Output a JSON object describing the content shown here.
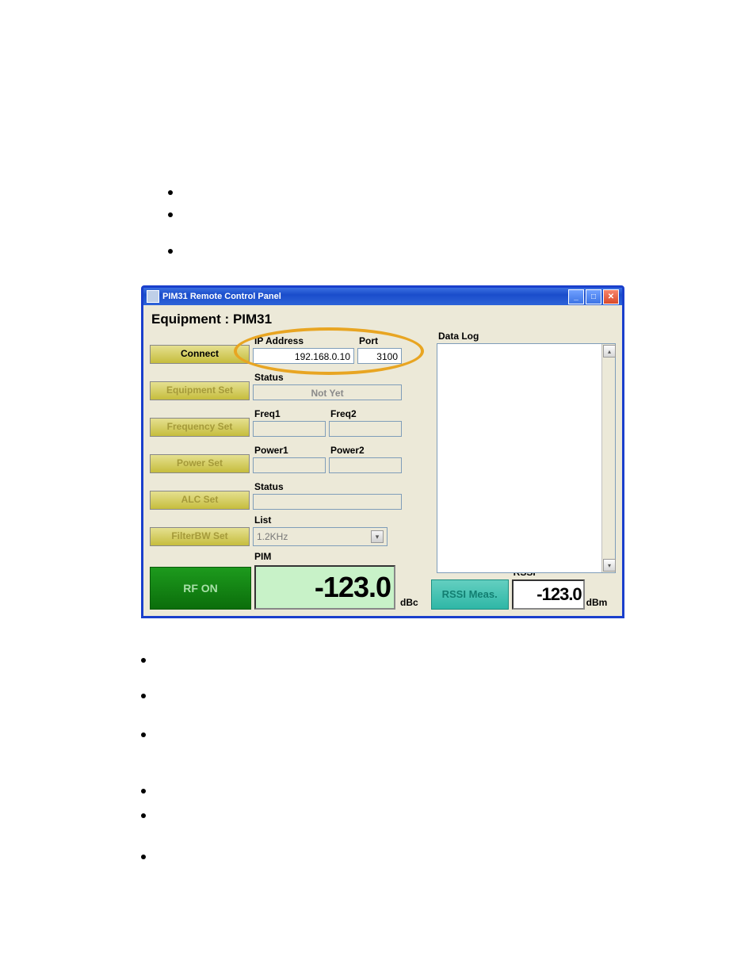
{
  "window": {
    "title": "PIM31 Remote Control Panel"
  },
  "header": {
    "equipment_label": "Equipment : PIM31"
  },
  "connect": {
    "button": "Connect",
    "ip_label": "IP Address",
    "ip_value": "192.168.0.10",
    "port_label": "Port",
    "port_value": "3100"
  },
  "equipment_set": {
    "button": "Equipment Set",
    "status_label": "Status",
    "status_value": "Not Yet"
  },
  "frequency_set": {
    "button": "Frequency Set",
    "freq1_label": "Freq1",
    "freq1_value": "",
    "freq2_label": "Freq2",
    "freq2_value": ""
  },
  "power_set": {
    "button": "Power Set",
    "power1_label": "Power1",
    "power1_value": "",
    "power2_label": "Power2",
    "power2_value": ""
  },
  "alc_set": {
    "button": "ALC Set",
    "status_label": "Status",
    "status_value": ""
  },
  "filterbw_set": {
    "button": "FilterBW Set",
    "list_label": "List",
    "list_value": "1.2KHz"
  },
  "pim": {
    "label": "PIM",
    "value": "-123.0",
    "unit": "dBc"
  },
  "rf": {
    "button": "RF ON"
  },
  "rssi": {
    "button": "RSSI Meas.",
    "label": "RSSI",
    "value": "-123.0",
    "unit": "dBm"
  },
  "datalog": {
    "label": "Data Log"
  }
}
